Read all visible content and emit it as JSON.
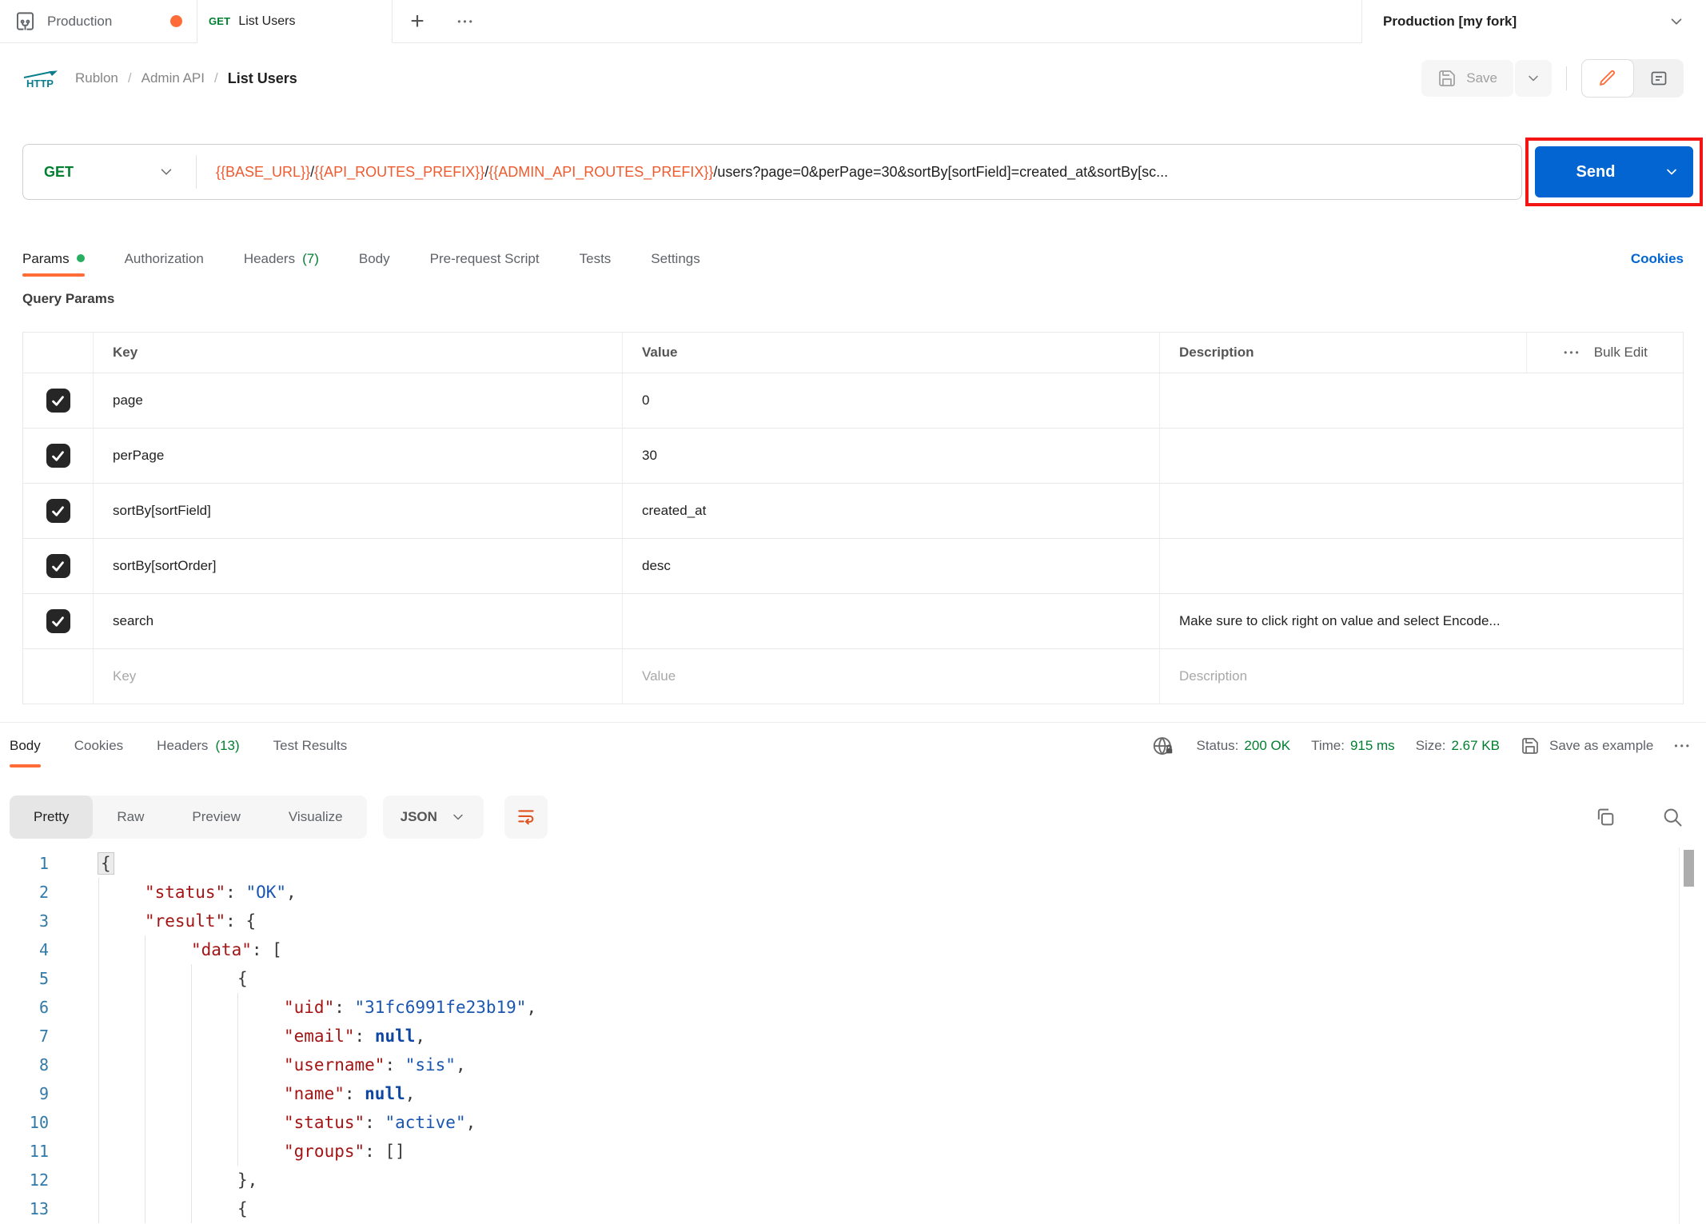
{
  "colors": {
    "accent_orange": "#ff6c37",
    "url_var_orange": "#ee5b2f",
    "method_green": "#007f31",
    "link_blue": "#0265d2",
    "send_blue": "#0265d2",
    "annotation_red": "#f31414",
    "code_key": "#a31515",
    "code_string": "#1a56b0",
    "code_null": "#0d47a1",
    "line_number": "#3179a8"
  },
  "icons": {
    "workspace": "collection-fork-icon",
    "unsaved_dot": "orange-dot",
    "more_dots": "•••",
    "plus": "+",
    "http_badge": "HTTP"
  },
  "topbar": {
    "workspace": "Production",
    "tab": {
      "method": "GET",
      "title": "List Users"
    },
    "plus_label": "+",
    "more_label": "•••",
    "env_selector": "Production [my fork]"
  },
  "breadcrumb": {
    "http_badge": "HTTP",
    "items": [
      "Rublon",
      "Admin API"
    ],
    "separator": "/",
    "current": "List Users",
    "save_label": "Save"
  },
  "request": {
    "method": "GET",
    "url_segments": [
      {
        "type": "var",
        "text": "{{BASE_URL}}"
      },
      {
        "type": "plain",
        "text": "/"
      },
      {
        "type": "var",
        "text": "{{API_ROUTES_PREFIX}}"
      },
      {
        "type": "plain",
        "text": "/"
      },
      {
        "type": "var",
        "text": "{{ADMIN_API_ROUTES_PREFIX}}"
      },
      {
        "type": "plain",
        "text": "/users?page=0&perPage=30&sortBy[sortField]=created_at&sortBy[sc..."
      }
    ],
    "send_label": "Send",
    "tabs": [
      {
        "label": "Params",
        "active": true,
        "dot": true
      },
      {
        "label": "Authorization"
      },
      {
        "label": "Headers",
        "count": "(7)"
      },
      {
        "label": "Body"
      },
      {
        "label": "Pre-request Script"
      },
      {
        "label": "Tests"
      },
      {
        "label": "Settings"
      }
    ],
    "cookies_link": "Cookies"
  },
  "params": {
    "title": "Query Params",
    "headers": {
      "key": "Key",
      "value": "Value",
      "description": "Description"
    },
    "bulk_edit": "Bulk Edit",
    "rows": [
      {
        "checked": true,
        "key": "page",
        "value": "0",
        "description": ""
      },
      {
        "checked": true,
        "key": "perPage",
        "value": "30",
        "description": ""
      },
      {
        "checked": true,
        "key": "sortBy[sortField]",
        "value": "created_at",
        "description": ""
      },
      {
        "checked": true,
        "key": "sortBy[sortOrder]",
        "value": "desc",
        "description": ""
      },
      {
        "checked": true,
        "key": "search",
        "value": "",
        "description": "Make sure to click right on value and select Encode..."
      }
    ],
    "placeholder_row": {
      "key": "Key",
      "value": "Value",
      "description": "Description"
    }
  },
  "response": {
    "tabs": [
      {
        "label": "Body",
        "active": true
      },
      {
        "label": "Cookies"
      },
      {
        "label": "Headers",
        "count": "(13)"
      },
      {
        "label": "Test Results"
      }
    ],
    "meta": [
      {
        "label": "Status:",
        "value": "200 OK"
      },
      {
        "label": "Time:",
        "value": "915 ms"
      },
      {
        "label": "Size:",
        "value": "2.67 KB"
      }
    ],
    "save_as_example": "Save as example",
    "more_label": "•••",
    "view_tabs": [
      {
        "label": "Pretty",
        "active": true
      },
      {
        "label": "Raw"
      },
      {
        "label": "Preview"
      },
      {
        "label": "Visualize"
      }
    ],
    "format": "JSON",
    "code_lines": [
      {
        "n": 1,
        "indent": 0,
        "tokens": [
          [
            "punc-hl",
            "{"
          ]
        ]
      },
      {
        "n": 2,
        "indent": 1,
        "tokens": [
          [
            "key",
            "\"status\""
          ],
          [
            "punc",
            ": "
          ],
          [
            "str",
            "\"OK\""
          ],
          [
            "punc",
            ","
          ]
        ]
      },
      {
        "n": 3,
        "indent": 1,
        "tokens": [
          [
            "key",
            "\"result\""
          ],
          [
            "punc",
            ": {"
          ]
        ]
      },
      {
        "n": 4,
        "indent": 2,
        "tokens": [
          [
            "key",
            "\"data\""
          ],
          [
            "punc",
            ": ["
          ]
        ]
      },
      {
        "n": 5,
        "indent": 3,
        "tokens": [
          [
            "punc",
            "{"
          ]
        ]
      },
      {
        "n": 6,
        "indent": 4,
        "tokens": [
          [
            "key",
            "\"uid\""
          ],
          [
            "punc",
            ": "
          ],
          [
            "str",
            "\"31fc6991fe23b19\""
          ],
          [
            "punc",
            ","
          ]
        ]
      },
      {
        "n": 7,
        "indent": 4,
        "tokens": [
          [
            "key",
            "\"email\""
          ],
          [
            "punc",
            ": "
          ],
          [
            "null",
            "null"
          ],
          [
            "punc",
            ","
          ]
        ]
      },
      {
        "n": 8,
        "indent": 4,
        "tokens": [
          [
            "key",
            "\"username\""
          ],
          [
            "punc",
            ": "
          ],
          [
            "str",
            "\"sis\""
          ],
          [
            "punc",
            ","
          ]
        ]
      },
      {
        "n": 9,
        "indent": 4,
        "tokens": [
          [
            "key",
            "\"name\""
          ],
          [
            "punc",
            ": "
          ],
          [
            "null",
            "null"
          ],
          [
            "punc",
            ","
          ]
        ]
      },
      {
        "n": 10,
        "indent": 4,
        "tokens": [
          [
            "key",
            "\"status\""
          ],
          [
            "punc",
            ": "
          ],
          [
            "str",
            "\"active\""
          ],
          [
            "punc",
            ","
          ]
        ]
      },
      {
        "n": 11,
        "indent": 4,
        "tokens": [
          [
            "key",
            "\"groups\""
          ],
          [
            "punc",
            ": []"
          ]
        ]
      },
      {
        "n": 12,
        "indent": 3,
        "tokens": [
          [
            "punc",
            "},"
          ]
        ]
      },
      {
        "n": 13,
        "indent": 3,
        "tokens": [
          [
            "punc",
            "{"
          ]
        ]
      }
    ]
  }
}
